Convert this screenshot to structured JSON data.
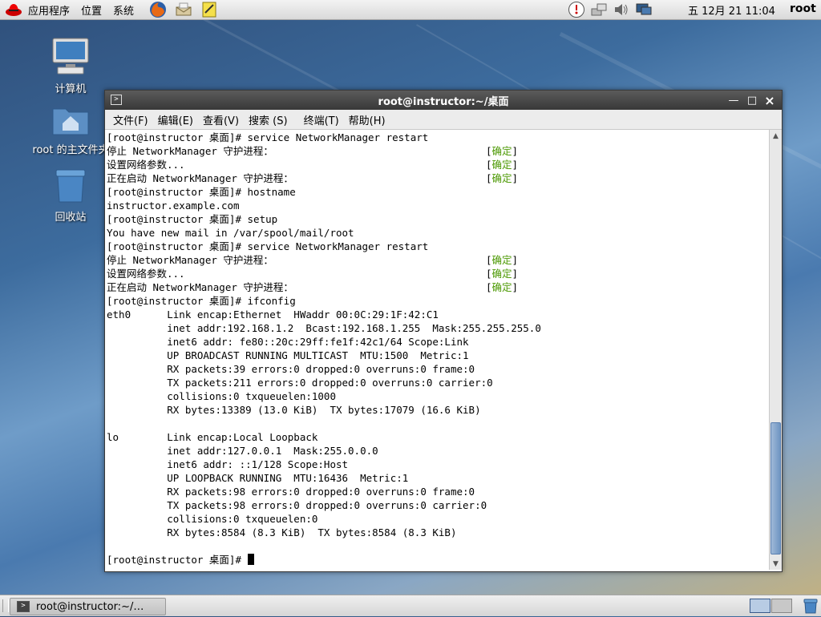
{
  "top_panel": {
    "menus": [
      "应用程序",
      "位置",
      "系统"
    ],
    "clock": "五 12月 21 11:04",
    "user": "root"
  },
  "desktop": {
    "icons": [
      {
        "label": "计算机",
        "icon": "computer-icon"
      },
      {
        "label": "root 的主文件夹",
        "icon": "home-folder-icon"
      },
      {
        "label": "回收站",
        "icon": "trash-icon"
      }
    ]
  },
  "terminal": {
    "title": "root@instructor:~/桌面",
    "menu": [
      "文件(F)",
      "编辑(E)",
      "查看(V)",
      "搜索 (S)",
      "终端(T)",
      "帮助(H)"
    ],
    "lines": [
      {
        "text": "[root@instructor 桌面]# service NetworkManager restart"
      },
      {
        "text": "停止 NetworkManager 守护进程：",
        "status": "确定"
      },
      {
        "text": "设置网络参数...",
        "status": "确定"
      },
      {
        "text": "正在启动 NetworkManager 守护进程：",
        "status": "确定"
      },
      {
        "text": "[root@instructor 桌面]# hostname"
      },
      {
        "text": "instructor.example.com"
      },
      {
        "text": "[root@instructor 桌面]# setup"
      },
      {
        "text": "You have new mail in /var/spool/mail/root"
      },
      {
        "text": "[root@instructor 桌面]# service NetworkManager restart"
      },
      {
        "text": "停止 NetworkManager 守护进程：",
        "status": "确定"
      },
      {
        "text": "设置网络参数...",
        "status": "确定"
      },
      {
        "text": "正在启动 NetworkManager 守护进程：",
        "status": "确定"
      },
      {
        "text": "[root@instructor 桌面]# ifconfig"
      },
      {
        "text": "eth0      Link encap:Ethernet  HWaddr 00:0C:29:1F:42:C1"
      },
      {
        "text": "          inet addr:192.168.1.2  Bcast:192.168.1.255  Mask:255.255.255.0"
      },
      {
        "text": "          inet6 addr: fe80::20c:29ff:fe1f:42c1/64 Scope:Link"
      },
      {
        "text": "          UP BROADCAST RUNNING MULTICAST  MTU:1500  Metric:1"
      },
      {
        "text": "          RX packets:39 errors:0 dropped:0 overruns:0 frame:0"
      },
      {
        "text": "          TX packets:211 errors:0 dropped:0 overruns:0 carrier:0"
      },
      {
        "text": "          collisions:0 txqueuelen:1000"
      },
      {
        "text": "          RX bytes:13389 (13.0 KiB)  TX bytes:17079 (16.6 KiB)"
      },
      {
        "text": ""
      },
      {
        "text": "lo        Link encap:Local Loopback"
      },
      {
        "text": "          inet addr:127.0.0.1  Mask:255.0.0.0"
      },
      {
        "text": "          inet6 addr: ::1/128 Scope:Host"
      },
      {
        "text": "          UP LOOPBACK RUNNING  MTU:16436  Metric:1"
      },
      {
        "text": "          RX packets:98 errors:0 dropped:0 overruns:0 frame:0"
      },
      {
        "text": "          TX packets:98 errors:0 dropped:0 overruns:0 carrier:0"
      },
      {
        "text": "          collisions:0 txqueuelen:0"
      },
      {
        "text": "          RX bytes:8584 (8.3 KiB)  TX bytes:8584 (8.3 KiB)"
      },
      {
        "text": ""
      },
      {
        "text": "[root@instructor 桌面]# ",
        "cursor": true
      }
    ]
  },
  "taskbar": {
    "task_label": "root@instructor:~/…"
  }
}
